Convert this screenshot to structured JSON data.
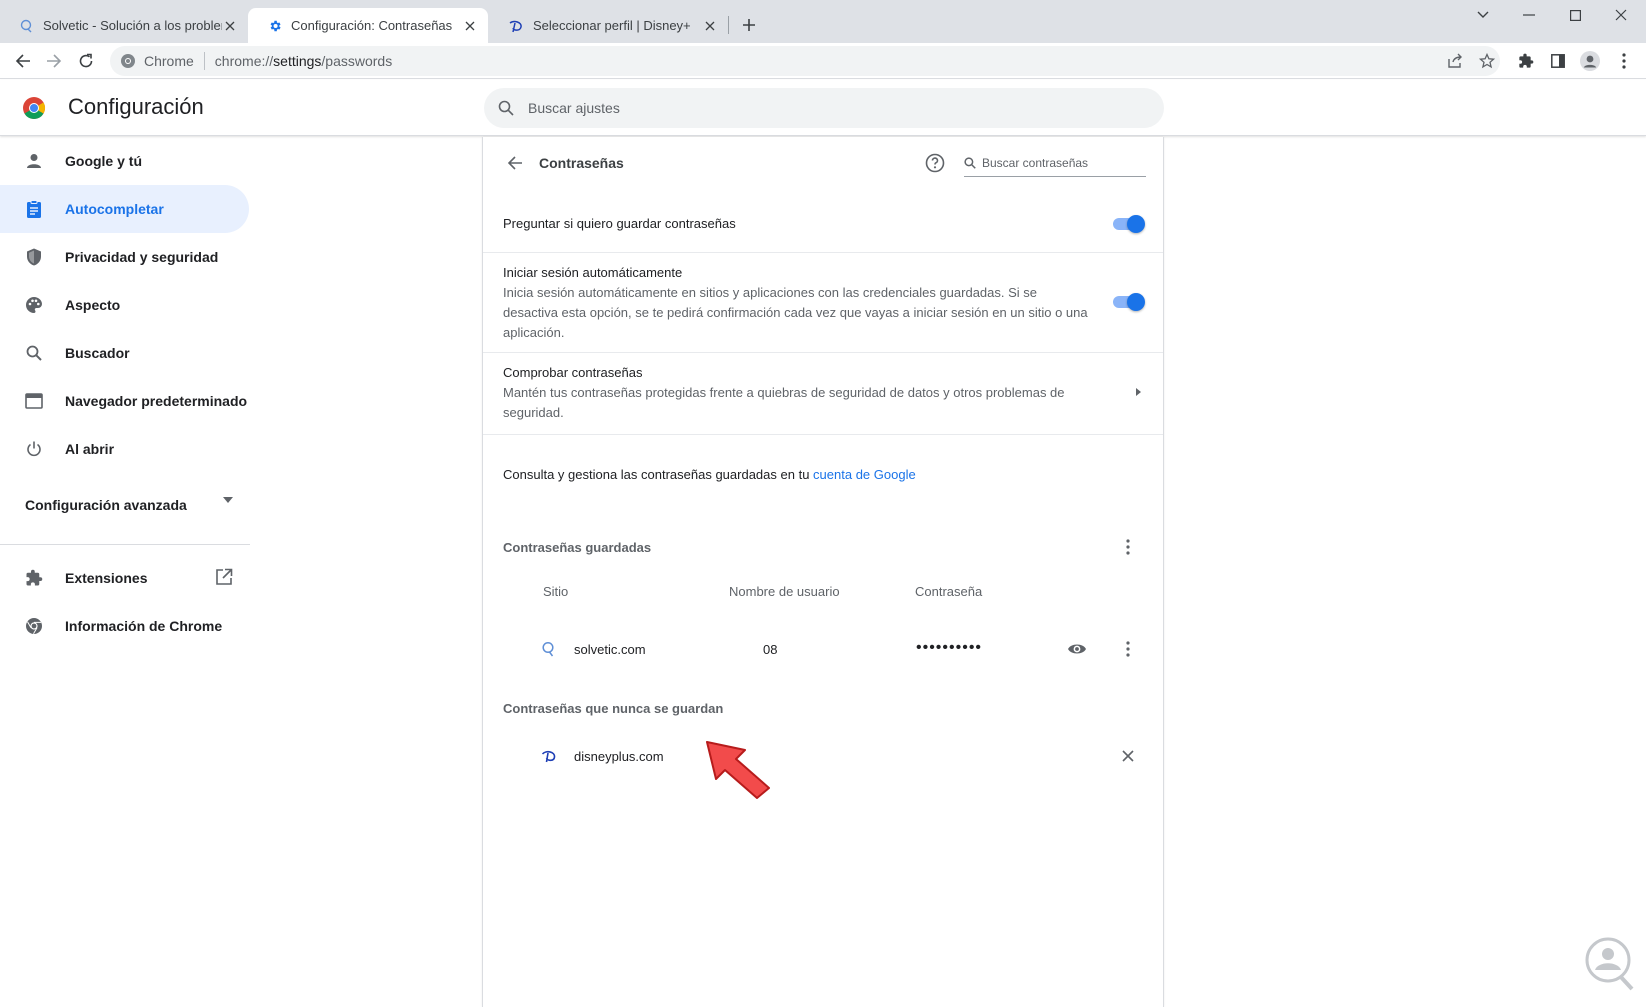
{
  "browser": {
    "tabs": [
      {
        "title": "Solvetic - Solución a los problemas",
        "icon": "solvetic-favicon"
      },
      {
        "title": "Configuración: Contraseñas",
        "icon": "settings-gear-icon"
      },
      {
        "title": "Seleccionar perfil | Disney+",
        "icon": "disney-favicon"
      }
    ],
    "omnibox": {
      "chip": "Chrome",
      "url_prefix": "chrome://",
      "url_host": "settings",
      "url_path": "/passwords"
    }
  },
  "settings": {
    "title": "Configuración",
    "search_placeholder": "Buscar ajustes"
  },
  "sidebar": {
    "items": [
      {
        "label": "Google y tú",
        "icon": "person-icon"
      },
      {
        "label": "Autocompletar",
        "icon": "clipboard-icon"
      },
      {
        "label": "Privacidad y seguridad",
        "icon": "shield-icon"
      },
      {
        "label": "Aspecto",
        "icon": "palette-icon"
      },
      {
        "label": "Buscador",
        "icon": "search-icon"
      },
      {
        "label": "Navegador predeterminado",
        "icon": "browser-icon"
      },
      {
        "label": "Al abrir",
        "icon": "power-icon"
      }
    ],
    "advanced": "Configuración avanzada",
    "extensions": "Extensiones",
    "about": "Información de Chrome"
  },
  "passwords": {
    "title": "Contraseñas",
    "search_placeholder": "Buscar contraseñas",
    "offer_save": {
      "label": "Preguntar si quiero guardar contraseñas"
    },
    "auto_signin": {
      "label": "Iniciar sesión automáticamente",
      "description": "Inicia sesión automáticamente en sitios y aplicaciones con las credenciales guardadas. Si se desactiva esta opción, se te pedirá confirmación cada vez que vayas a iniciar sesión en un sitio o una aplicación."
    },
    "check": {
      "label": "Comprobar contraseñas",
      "description": "Mantén tus contraseñas protegidas frente a quiebras de seguridad de datos y otros problemas de seguridad."
    },
    "manage_text": "Consulta y gestiona las contraseñas guardadas en tu ",
    "manage_link": "cuenta de Google",
    "saved_title": "Contraseñas guardadas",
    "columns": {
      "site": "Sitio",
      "user": "Nombre de usuario",
      "password": "Contraseña"
    },
    "saved": [
      {
        "site": "solvetic.com",
        "user": "08",
        "password": "••••••••••"
      }
    ],
    "never_title": "Contraseñas que nunca se guardan",
    "never": [
      {
        "site": "disneyplus.com"
      }
    ]
  },
  "colors": {
    "accent": "#1a73e8",
    "active_bg": "#e8f0fe",
    "annotation_arrow": "#f24b4b"
  }
}
